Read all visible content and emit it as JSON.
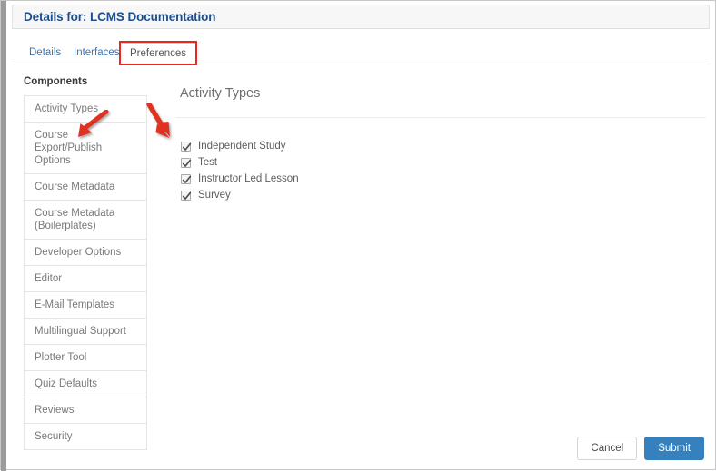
{
  "header": {
    "title": "Details for: LCMS Documentation"
  },
  "tabs": [
    {
      "label": "Details",
      "active": false
    },
    {
      "label": "Interfaces",
      "active": false
    },
    {
      "label": "Preferences",
      "active": true
    }
  ],
  "sidebar": {
    "heading": "Components",
    "items": [
      {
        "label": "Activity Types",
        "selected": true
      },
      {
        "label": "Course Export/Publish Options",
        "selected": false
      },
      {
        "label": "Course Metadata",
        "selected": false
      },
      {
        "label": "Course Metadata (Boilerplates)",
        "selected": false
      },
      {
        "label": "Developer Options",
        "selected": false
      },
      {
        "label": "Editor",
        "selected": false
      },
      {
        "label": "E-Mail Templates",
        "selected": false
      },
      {
        "label": "Multilingual Support",
        "selected": false
      },
      {
        "label": "Plotter Tool",
        "selected": false
      },
      {
        "label": "Quiz Defaults",
        "selected": false
      },
      {
        "label": "Reviews",
        "selected": false
      },
      {
        "label": "Security",
        "selected": false
      }
    ]
  },
  "main": {
    "title": "Activity Types",
    "checkboxes": [
      {
        "label": "Independent Study",
        "checked": true
      },
      {
        "label": "Test",
        "checked": true
      },
      {
        "label": "Instructor Led Lesson",
        "checked": true
      },
      {
        "label": "Survey",
        "checked": true
      }
    ]
  },
  "footer": {
    "cancel_label": "Cancel",
    "submit_label": "Submit"
  },
  "annotations": [
    {
      "name": "arrow-to-activity-types",
      "color": "#e03020",
      "direction": "down-left"
    },
    {
      "name": "arrow-to-first-checkbox",
      "color": "#e03020",
      "direction": "down-right"
    }
  ],
  "colors": {
    "title": "#1e4d8c",
    "tab_link": "#3876b8",
    "submit": "#3580bd",
    "highlight": "#e8291c",
    "arrow": "#e03020"
  }
}
